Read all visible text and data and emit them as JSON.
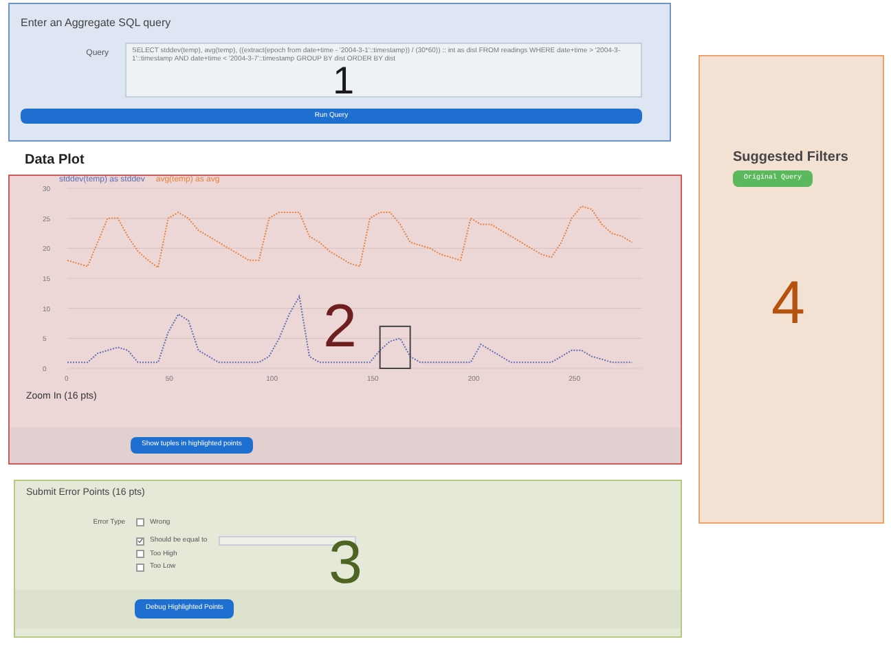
{
  "query_panel": {
    "title": "Enter an Aggregate SQL query",
    "label": "Query",
    "query": "SELECT stddev(temp), avg(temp), ((extract(epoch from date+time - '2004-3-1'::timestamp)) / (30*60)) :: int as dist FROM readings WHERE date+time > '2004-3-1'::timestamp AND date+time < '2004-3-7'::timestamp GROUP BY dist ORDER BY dist",
    "button": "Run Query",
    "annotation": "1"
  },
  "plot_panel": {
    "title": "Data Plot",
    "annotation": "2",
    "zoom_label": "Zoom In (16 pts)",
    "button": "Show tuples in highlighted points",
    "chart_data": {
      "type": "line",
      "x": [
        0,
        5,
        10,
        15,
        20,
        25,
        30,
        35,
        40,
        45,
        50,
        55,
        60,
        65,
        70,
        75,
        80,
        85,
        90,
        95,
        100,
        105,
        110,
        115,
        120,
        125,
        130,
        135,
        140,
        145,
        150,
        155,
        160,
        165,
        170,
        175,
        180,
        185,
        190,
        195,
        200,
        205,
        210,
        215,
        220,
        225,
        230,
        235,
        240,
        245,
        250,
        255,
        260,
        265,
        270,
        275,
        280
      ],
      "series": [
        {
          "name": "stddev(temp) as stddev",
          "color": "#5b6fb5",
          "line_style": "dotted",
          "values": [
            1,
            1,
            1,
            2.5,
            3,
            3.5,
            3,
            1,
            1,
            1,
            6,
            9,
            8,
            3,
            2,
            1,
            1,
            1,
            1,
            1,
            2,
            5,
            9,
            12,
            2,
            1,
            1,
            1,
            1,
            1,
            1,
            3,
            4.5,
            5,
            2,
            1,
            1,
            1,
            1,
            1,
            1,
            4,
            3,
            2,
            1,
            1,
            1,
            1,
            1,
            2,
            3,
            3,
            2,
            1.5,
            1,
            1,
            1
          ]
        },
        {
          "name": "avg(temp) as avg",
          "color": "#e8823a",
          "line_style": "dotted",
          "values": [
            18,
            17.5,
            17,
            21,
            25,
            25,
            22,
            19.5,
            18,
            16.8,
            25,
            26,
            25,
            23,
            22,
            21,
            20,
            19,
            18,
            18,
            25,
            26,
            26,
            26,
            22,
            21,
            19.5,
            18.5,
            17.5,
            17,
            25,
            26,
            26,
            24,
            21,
            20.5,
            20,
            19,
            18.5,
            18,
            25,
            24,
            24,
            23,
            22,
            21,
            20,
            19,
            18.5,
            21,
            25,
            27,
            26.5,
            24,
            22.5,
            22,
            21
          ]
        }
      ],
      "xticks": [
        0,
        50,
        100,
        150,
        200,
        250
      ],
      "yticks": [
        0,
        5,
        10,
        15,
        20,
        25,
        30
      ],
      "ylim": [
        0,
        30
      ],
      "xlim": [
        0,
        285
      ],
      "grid": true
    }
  },
  "error_panel": {
    "title": "Submit Error Points (16 pts)",
    "label": "Error Type",
    "options": [
      {
        "label": "Wrong",
        "checked": false,
        "kind": "check"
      },
      {
        "label": "Should be equal to",
        "checked": true,
        "kind": "check-input"
      },
      {
        "label": "Too High",
        "checked": false,
        "kind": "check"
      },
      {
        "label": "Too Low",
        "checked": false,
        "kind": "check"
      }
    ],
    "button": "Debug Highlighted Points",
    "annotation": "3"
  },
  "filters_panel": {
    "title": "Suggested Filters",
    "button": "Original Query",
    "annotation": "4"
  }
}
